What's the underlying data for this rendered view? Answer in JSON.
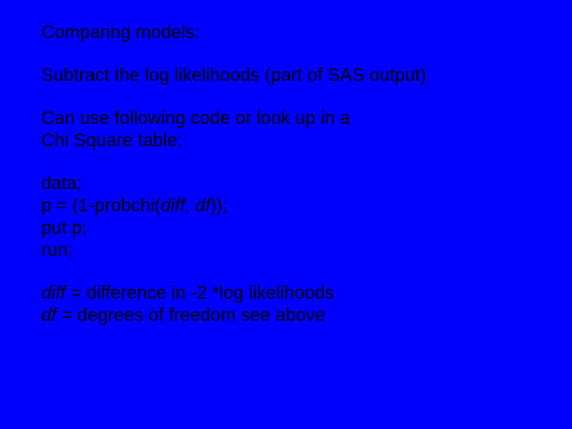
{
  "slide": {
    "title": "Comparing models:",
    "line1": "Subtract the log likelihoods (part of SAS output)",
    "line2a": "Can use following code or look up in a",
    "line2b": "Chi Square table:",
    "code1": "data;",
    "code2_pre": "p = (1-probchi(",
    "code2_args": "diff, df",
    "code2_post": "));",
    "code3": "put p;",
    "code4": "run;",
    "def1_term": "diff",
    "def1_rest": " = difference in -2 *log likelihoods",
    "def2_term": "df",
    "def2_rest": " = degrees of freedom see above"
  }
}
